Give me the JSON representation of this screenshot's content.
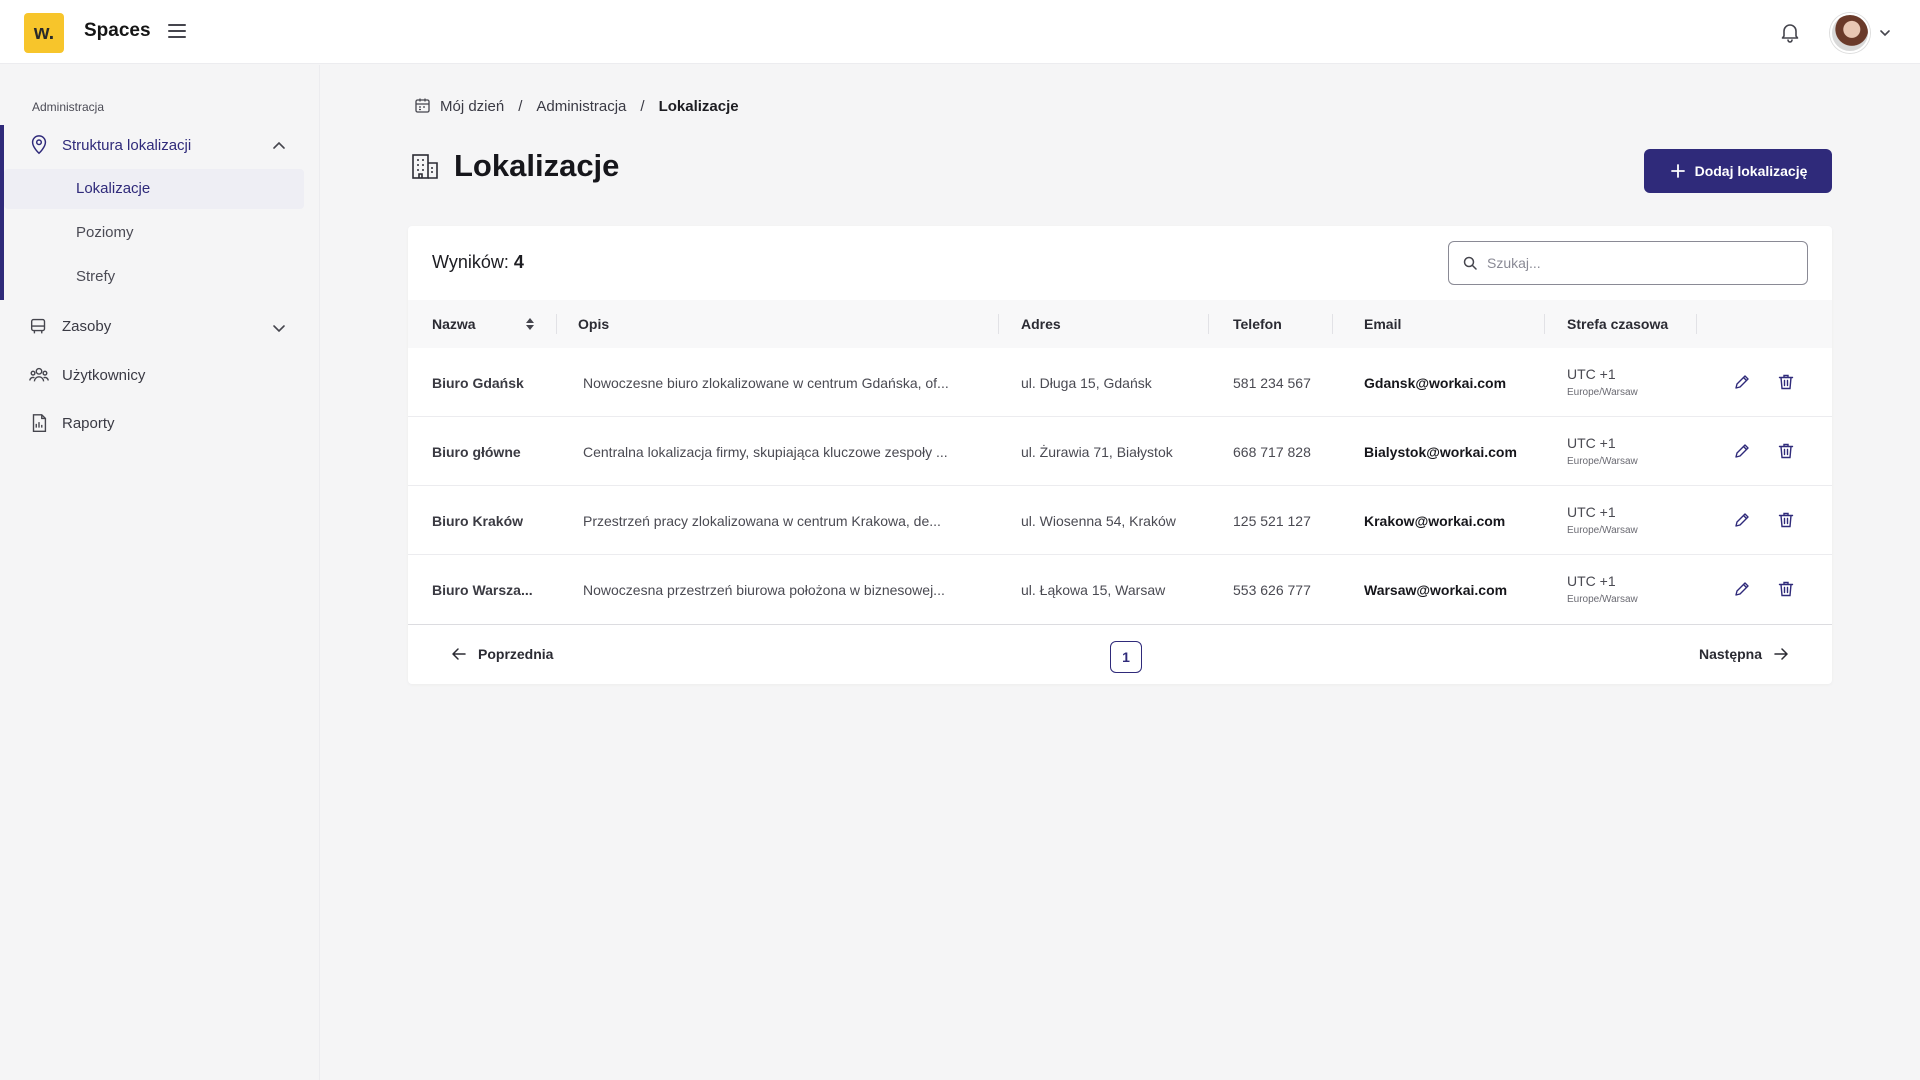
{
  "topbar": {
    "logo_text": "w.",
    "app_title": "Spaces"
  },
  "sidebar": {
    "section_label": "Administracja",
    "items": [
      {
        "label": "Struktura lokalizacji"
      },
      {
        "label": "Zasoby"
      },
      {
        "label": "Użytkownicy"
      },
      {
        "label": "Raporty"
      }
    ],
    "sub_items": [
      {
        "label": "Lokalizacje"
      },
      {
        "label": "Poziomy"
      },
      {
        "label": "Strefy"
      }
    ]
  },
  "breadcrumb": {
    "items": [
      "Mój dzień",
      "Administracja",
      "Lokalizacje"
    ],
    "separator": "/"
  },
  "page": {
    "title": "Lokalizacje",
    "add_button": "Dodaj lokalizację"
  },
  "table": {
    "results_label": "Wyników:",
    "results_count": "4",
    "search_placeholder": "Szukaj...",
    "columns": [
      "Nazwa",
      "Opis",
      "Adres",
      "Telefon",
      "Email",
      "Strefa czasowa"
    ],
    "rows": [
      {
        "name": "Biuro Gdańsk",
        "description": "Nowoczesne biuro zlokalizowane w centrum Gdańska, of...",
        "address": "ul. Długa 15, Gdańsk",
        "phone": "581 234 567",
        "email": "Gdansk@workai.com",
        "tz": "UTC +1",
        "tz_region": "Europe/Warsaw"
      },
      {
        "name": "Biuro główne",
        "description": "Centralna lokalizacja firmy, skupiająca kluczowe zespoły ...",
        "address": "ul. Żurawia 71, Białystok",
        "phone": "668 717 828",
        "email": "Bialystok@workai.com",
        "tz": "UTC +1",
        "tz_region": "Europe/Warsaw"
      },
      {
        "name": "Biuro Kraków",
        "description": "Przestrzeń pracy zlokalizowana w centrum Krakowa, de...",
        "address": "ul. Wiosenna 54, Kraków",
        "phone": "125 521 127",
        "email": "Krakow@workai.com",
        "tz": "UTC +1",
        "tz_region": "Europe/Warsaw"
      },
      {
        "name": "Biuro Warsza...",
        "description": "Nowoczesna przestrzeń biurowa położona w biznesowej...",
        "address": "ul. Łąkowa 15, Warsaw",
        "phone": "553 626 777",
        "email": "Warsaw@workai.com",
        "tz": "UTC +1",
        "tz_region": "Europe/Warsaw"
      }
    ]
  },
  "pagination": {
    "prev_label": "Poprzednia",
    "next_label": "Następna",
    "current_page": "1"
  },
  "colors": {
    "accent": "#2f2a7a",
    "logo": "#f7c52b"
  },
  "icons": {
    "logo": "workai-logo",
    "menu": "hamburger-icon",
    "notifications": "bell-icon",
    "location": "map-pin-icon",
    "resources": "resources-icon",
    "users": "users-icon",
    "reports": "report-icon",
    "building": "building-icon",
    "calendar": "calendar-icon",
    "plus": "plus-icon",
    "search": "search-icon",
    "sort": "sort-icon",
    "edit": "pencil-icon",
    "delete": "trash-icon",
    "prev": "arrow-left-icon",
    "next": "arrow-right-icon"
  }
}
